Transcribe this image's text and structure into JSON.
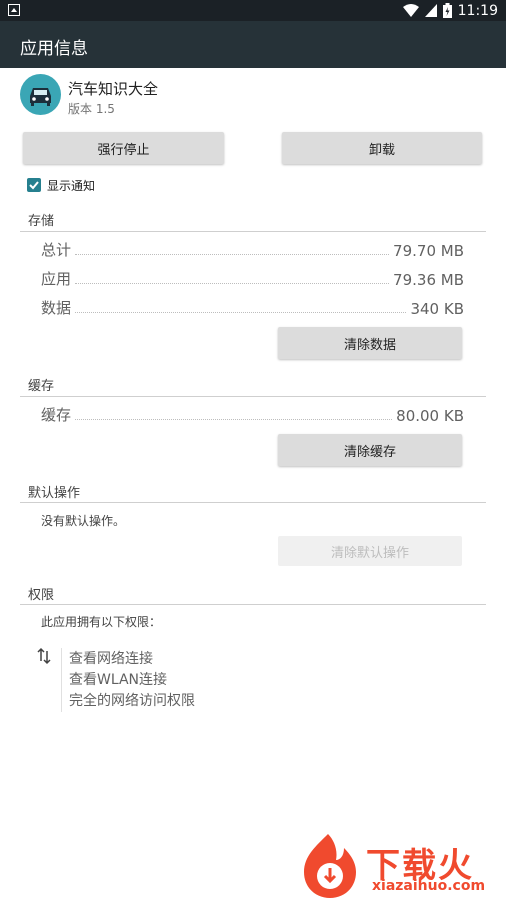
{
  "status_bar": {
    "time": "11:19"
  },
  "action_bar": {
    "title": "应用信息"
  },
  "app": {
    "name": "汽车知识大全",
    "version": "版本 1.5"
  },
  "buttons": {
    "force_stop": "强行停止",
    "uninstall": "卸载",
    "clear_data": "清除数据",
    "clear_cache": "清除缓存",
    "clear_defaults": "清除默认操作"
  },
  "notifications": {
    "label": "显示通知",
    "checked": true
  },
  "storage": {
    "title": "存储",
    "rows": [
      {
        "label": "总计",
        "value": "79.70 MB"
      },
      {
        "label": "应用",
        "value": "79.36 MB"
      },
      {
        "label": "数据",
        "value": "340 KB"
      }
    ]
  },
  "cache": {
    "title": "缓存",
    "label": "缓存",
    "value": "80.00 KB"
  },
  "defaults": {
    "title": "默认操作",
    "text": "没有默认操作。"
  },
  "permissions": {
    "title": "权限",
    "intro": "此应用拥有以下权限：",
    "items": [
      "查看网络连接",
      "查看WLAN连接",
      "完全的网络访问权限"
    ]
  },
  "watermark": {
    "brand": "下载火",
    "domain": "xiazaihuo.com"
  },
  "colors": {
    "action_bar": "#263238",
    "status_bar": "#1b2126",
    "accent": "#26808f",
    "app_icon": "#3aa6b5",
    "watermark": "#f04a2e"
  }
}
